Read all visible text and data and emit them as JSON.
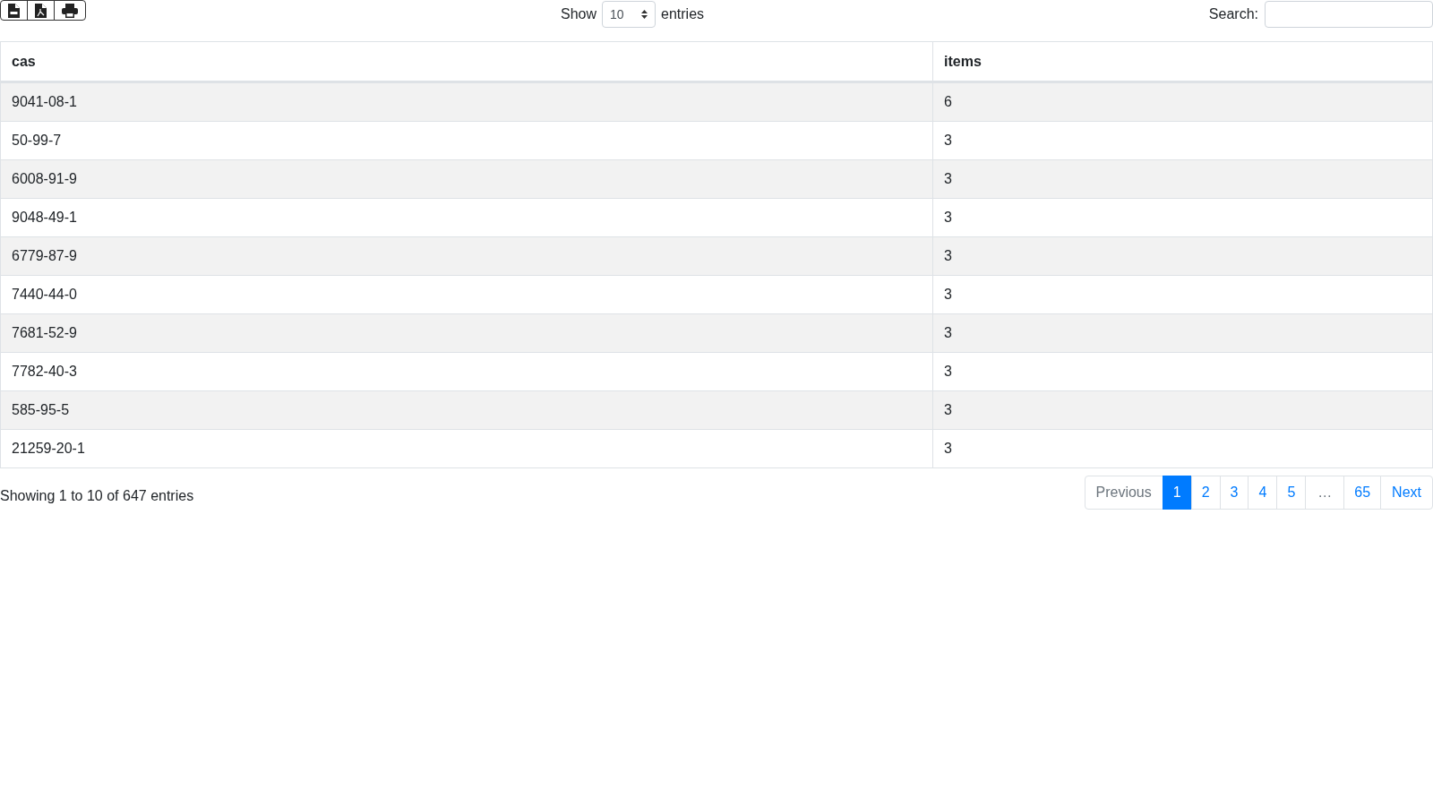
{
  "export_buttons": [
    {
      "kind": "csv"
    },
    {
      "kind": "pdf"
    },
    {
      "kind": "print"
    }
  ],
  "length_menu": {
    "label_before": "Show",
    "value": "10",
    "label_after": "entries"
  },
  "search": {
    "label": "Search:"
  },
  "table": {
    "columns": [
      "cas",
      "items"
    ],
    "rows": [
      [
        "9041-08-1",
        "6"
      ],
      [
        "50-99-7",
        "3"
      ],
      [
        "6008-91-9",
        "3"
      ],
      [
        "9048-49-1",
        "3"
      ],
      [
        "6779-87-9",
        "3"
      ],
      [
        "7440-44-0",
        "3"
      ],
      [
        "7681-52-9",
        "3"
      ],
      [
        "7782-40-3",
        "3"
      ],
      [
        "585-95-5",
        "3"
      ],
      [
        "21259-20-1",
        "3"
      ]
    ]
  },
  "info": "Showing 1 to 10 of 647 entries",
  "pagination": [
    {
      "label": "Previous",
      "kind": "nav",
      "selected": false,
      "disabled": true
    },
    {
      "label": "1",
      "kind": "page",
      "selected": true,
      "disabled": false
    },
    {
      "label": "2",
      "kind": "page",
      "selected": false,
      "disabled": false
    },
    {
      "label": "3",
      "kind": "page",
      "selected": false,
      "disabled": false
    },
    {
      "label": "4",
      "kind": "page",
      "selected": false,
      "disabled": false
    },
    {
      "label": "5",
      "kind": "page",
      "selected": false,
      "disabled": false
    },
    {
      "label": "…",
      "kind": "ellipsis",
      "selected": false,
      "disabled": true
    },
    {
      "label": "65",
      "kind": "page",
      "selected": false,
      "disabled": false
    },
    {
      "label": "Next",
      "kind": "nav",
      "selected": false,
      "disabled": false
    }
  ]
}
